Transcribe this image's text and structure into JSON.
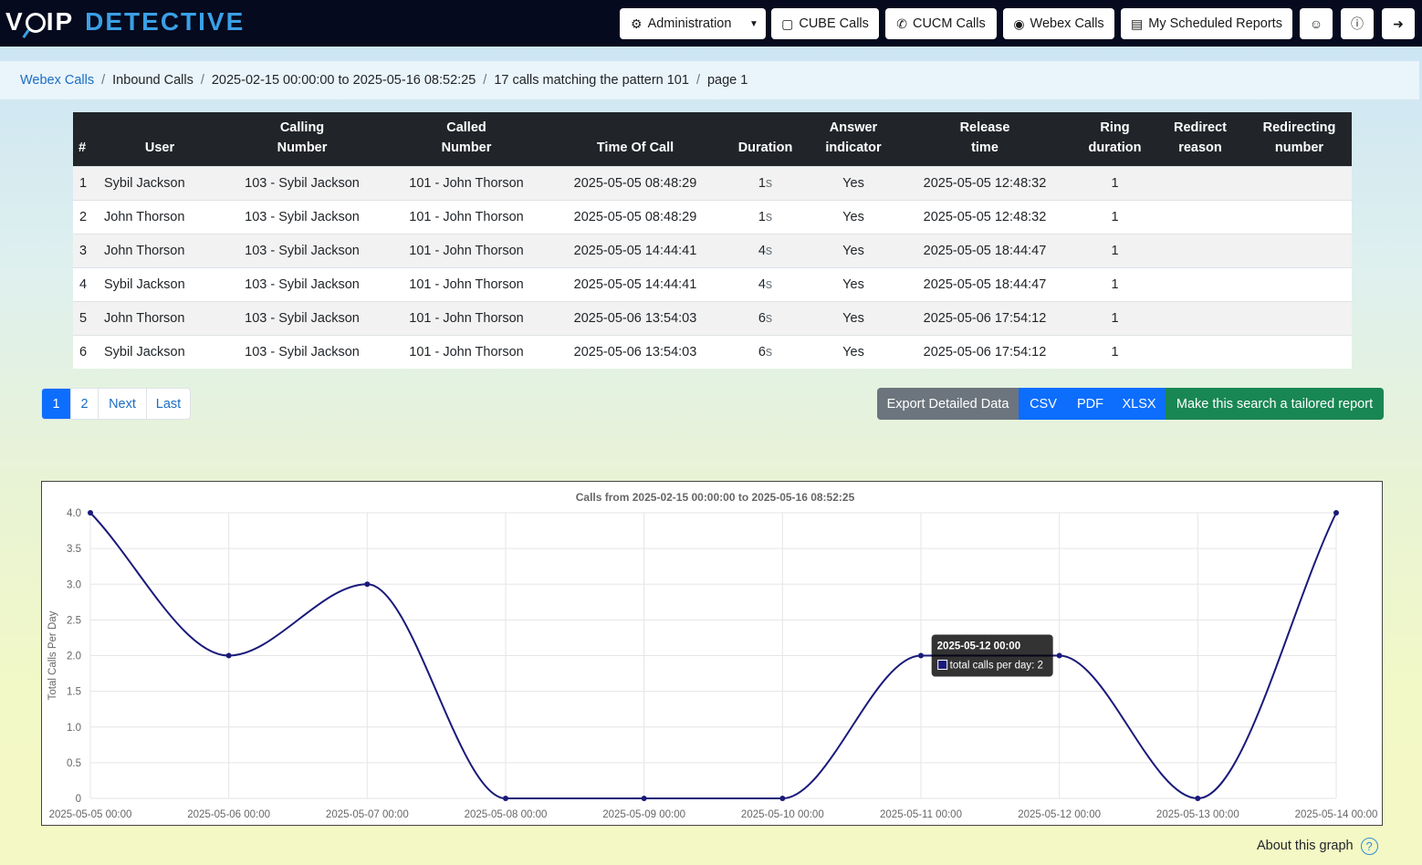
{
  "brand": {
    "part1": "V",
    "part2": "IP",
    "part3": "DETECTIVE"
  },
  "nav": {
    "administration": "Administration",
    "cube_calls": "CUBE Calls",
    "cucm_calls": "CUCM Calls",
    "webex_calls": "Webex Calls",
    "scheduled_reports": "My Scheduled Reports",
    "icons": [
      "gear-icon",
      "cube-icon",
      "phone-icon",
      "record-icon",
      "report-icon",
      "user-circle-icon",
      "help-icon",
      "logout-icon"
    ]
  },
  "breadcrumb": {
    "items": [
      "Webex Calls",
      "Inbound Calls",
      "2025-02-15 00:00:00 to 2025-05-16 08:52:25",
      "17 calls matching the pattern 101",
      "page 1"
    ]
  },
  "table": {
    "headers": [
      [
        "",
        "#"
      ],
      [
        "",
        "User"
      ],
      [
        "Calling",
        "Number"
      ],
      [
        "Called",
        "Number"
      ],
      [
        "",
        "Time Of Call"
      ],
      [
        "",
        "Duration"
      ],
      [
        "Answer",
        "indicator"
      ],
      [
        "Release",
        "time"
      ],
      [
        "Ring",
        "duration"
      ],
      [
        "Redirect",
        "reason"
      ],
      [
        "Redirecting",
        "number"
      ]
    ],
    "rows": [
      {
        "n": "1",
        "user": "Sybil Jackson",
        "calling": "103 - Sybil Jackson",
        "called": "101 - John Thorson",
        "time": "2025-05-05 08:48:29",
        "dur": "1",
        "unit": "s",
        "answer": "Yes",
        "release": "2025-05-05 12:48:32",
        "ring": "1",
        "reason": "",
        "redir": ""
      },
      {
        "n": "2",
        "user": "John Thorson",
        "calling": "103 - Sybil Jackson",
        "called": "101 - John Thorson",
        "time": "2025-05-05 08:48:29",
        "dur": "1",
        "unit": "s",
        "answer": "Yes",
        "release": "2025-05-05 12:48:32",
        "ring": "1",
        "reason": "",
        "redir": ""
      },
      {
        "n": "3",
        "user": "John Thorson",
        "calling": "103 - Sybil Jackson",
        "called": "101 - John Thorson",
        "time": "2025-05-05 14:44:41",
        "dur": "4",
        "unit": "s",
        "answer": "Yes",
        "release": "2025-05-05 18:44:47",
        "ring": "1",
        "reason": "",
        "redir": ""
      },
      {
        "n": "4",
        "user": "Sybil Jackson",
        "calling": "103 - Sybil Jackson",
        "called": "101 - John Thorson",
        "time": "2025-05-05 14:44:41",
        "dur": "4",
        "unit": "s",
        "answer": "Yes",
        "release": "2025-05-05 18:44:47",
        "ring": "1",
        "reason": "",
        "redir": ""
      },
      {
        "n": "5",
        "user": "John Thorson",
        "calling": "103 - Sybil Jackson",
        "called": "101 - John Thorson",
        "time": "2025-05-06 13:54:03",
        "dur": "6",
        "unit": "s",
        "answer": "Yes",
        "release": "2025-05-06 17:54:12",
        "ring": "1",
        "reason": "",
        "redir": ""
      },
      {
        "n": "6",
        "user": "Sybil Jackson",
        "calling": "103 - Sybil Jackson",
        "called": "101 - John Thorson",
        "time": "2025-05-06 13:54:03",
        "dur": "6",
        "unit": "s",
        "answer": "Yes",
        "release": "2025-05-06 17:54:12",
        "ring": "1",
        "reason": "",
        "redir": ""
      }
    ]
  },
  "pagination": {
    "pages": [
      "1",
      "2"
    ],
    "active": "1",
    "next": "Next",
    "last": "Last"
  },
  "exports": {
    "export": "Export Detailed Data",
    "csv": "CSV",
    "pdf": "PDF",
    "xlsx": "XLSX",
    "tailored": "Make this search a tailored report"
  },
  "about_graph": "About this graph",
  "colors": {
    "navbar": "#050a1e",
    "brand_accent": "#3aa0e6",
    "line": "#1a1a7a",
    "primary": "#0d6efd",
    "success": "#198754",
    "secondary": "#6c757d"
  },
  "chart_data": {
    "type": "line",
    "title": "Calls from 2025-02-15 00:00:00 to 2025-05-16 08:52:25",
    "xlabel": "",
    "ylabel": "Total Calls Per Day",
    "x": [
      "2025-05-05 00:00",
      "2025-05-06 00:00",
      "2025-05-07 00:00",
      "2025-05-08 00:00",
      "2025-05-09 00:00",
      "2025-05-10 00:00",
      "2025-05-11 00:00",
      "2025-05-12 00:00",
      "2025-05-13 00:00",
      "2025-05-14 00:00"
    ],
    "series": [
      {
        "values": [
          4,
          2,
          3,
          0,
          0,
          0,
          2,
          2,
          0,
          4
        ]
      }
    ],
    "ylim": [
      0,
      4
    ],
    "yticks": [
      "0",
      "0.5",
      "1.0",
      "1.5",
      "2.0",
      "2.5",
      "3.0",
      "3.5",
      "4.0"
    ],
    "grid": true,
    "tooltip": {
      "title": "2025-05-12 00:00",
      "text": "total calls per day: 2"
    }
  }
}
